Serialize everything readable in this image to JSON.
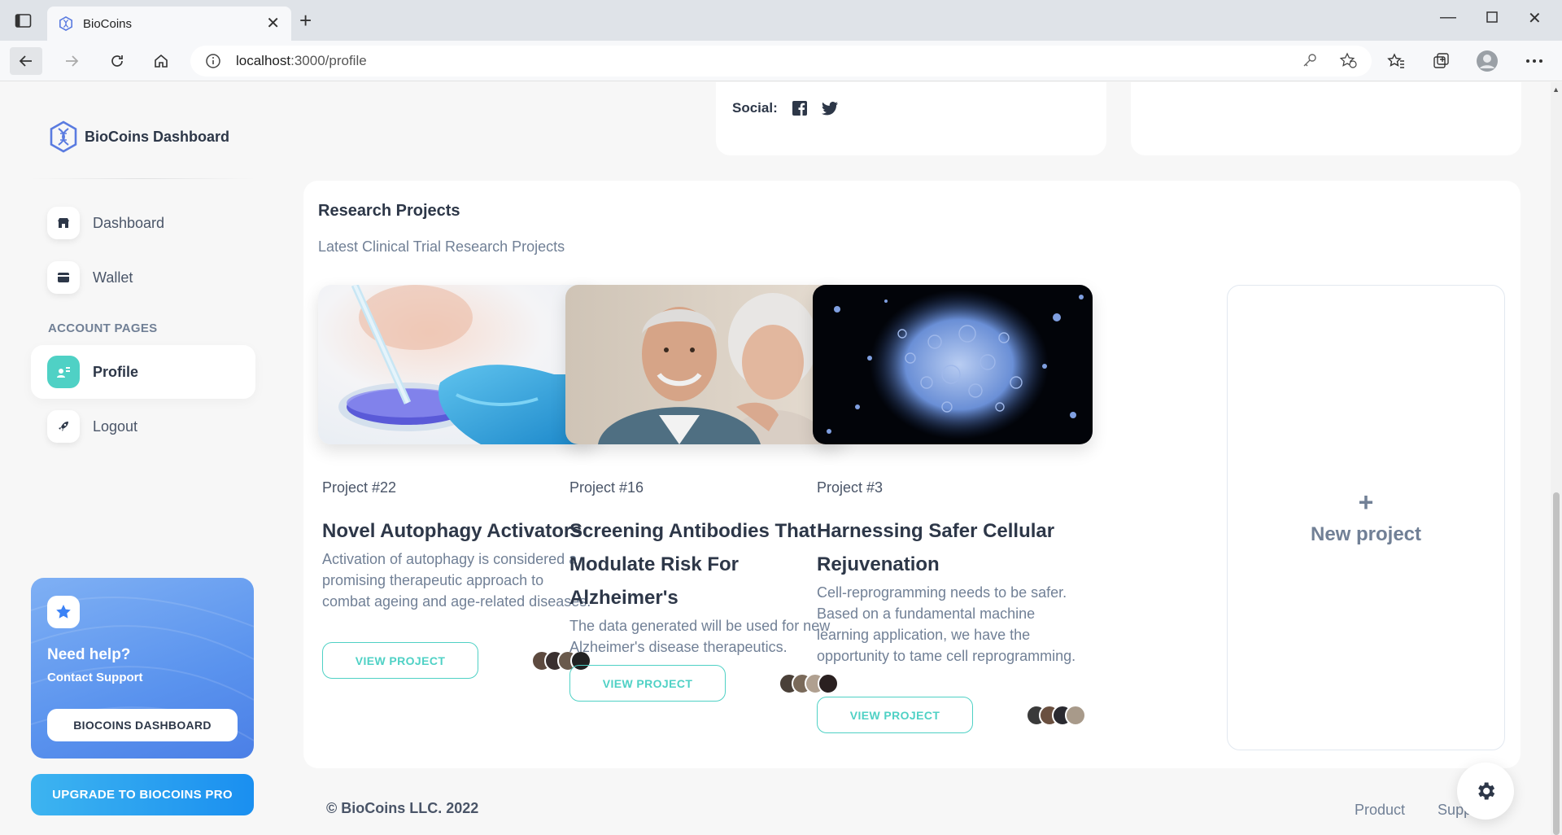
{
  "browser": {
    "tab_title": "BioCoins",
    "url_host": "localhost",
    "url_path": ":3000/profile"
  },
  "sidebar": {
    "brand": "BioCoins Dashboard",
    "items": [
      {
        "label": "Dashboard",
        "icon": "shop-icon"
      },
      {
        "label": "Wallet",
        "icon": "card-icon"
      }
    ],
    "section_title": "ACCOUNT PAGES",
    "account_items": [
      {
        "label": "Profile",
        "icon": "user-icon",
        "active": true
      },
      {
        "label": "Logout",
        "icon": "rocket-icon"
      }
    ],
    "help": {
      "title": "Need help?",
      "subtitle": "Contact Support",
      "button": "BIOCOINS DASHBOARD"
    },
    "upgrade_button": "UPGRADE TO BIOCOINS PRO"
  },
  "profile_info": {
    "social_label": "Social:"
  },
  "projects": {
    "title": "Research Projects",
    "subtitle": "Latest Clinical Trial Research Projects",
    "cards": [
      {
        "number": "Project #22",
        "name": "Novel Autophagy Activators",
        "description": "Activation of autophagy is considered a promising therapeutic approach to combat ageing and age-related diseases.",
        "button": "VIEW PROJECT"
      },
      {
        "number": "Project #16",
        "name": "Screening Antibodies That Modulate Risk For Alzheimer's",
        "description": "The data generated will be used for new Alzheimer's disease therapeutics.",
        "button": "VIEW PROJECT"
      },
      {
        "number": "Project #3",
        "name": "Harnessing Safer Cellular Rejuvenation",
        "description": "Cell-reprogramming needs to be safer. Based on a fundamental machine learning application, we have the opportunity to tame cell reprogramming.",
        "button": "VIEW PROJECT"
      }
    ],
    "new_project": "New project"
  },
  "footer": {
    "copyright": "© BioCoins LLC. 2022",
    "links": [
      "Product",
      "Supp"
    ]
  },
  "colors": {
    "accent": "#4fd1c5",
    "blue": "#1a8ff0"
  }
}
